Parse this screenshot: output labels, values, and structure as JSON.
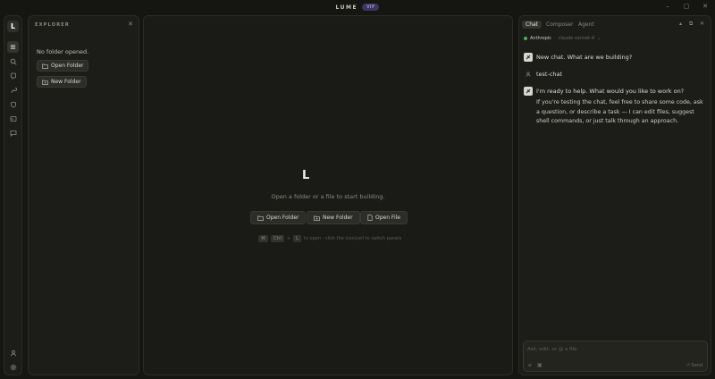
{
  "window": {
    "title": "LUME",
    "badge": "VIP"
  },
  "explorer": {
    "header": "EXPLORER",
    "empty_note": "No folder opened.",
    "open_folder_label": "Open Folder",
    "new_folder_label": "New Folder"
  },
  "editor": {
    "logo": "L",
    "hint": "Open a folder or a file to start building.",
    "open_folder_label": "Open Folder",
    "new_folder_label": "New Folder",
    "open_file_label": "Open File",
    "shortcut": {
      "keys": [
        "⌘",
        "Ctrl",
        "L"
      ],
      "text": "to open · click the icon/cell to switch panels"
    }
  },
  "chat": {
    "tabs": [
      "Chat",
      "Composer",
      "Agent"
    ],
    "active_tab": "Chat",
    "provider": "Anthropic",
    "model": "claude-sonnet-4",
    "messages": [
      {
        "role": "assistant",
        "text": "New chat. What are we building?"
      },
      {
        "role": "user",
        "text": "test-chat"
      },
      {
        "role": "assistant",
        "text": "I'm ready to help. What would you like to work on?",
        "detail": "If you're testing the chat, feel free to share some code, ask a question, or describe a task — I can edit files, suggest shell commands, or just talk through an approach."
      }
    ],
    "input_placeholder": "Ask, edit, or @ a file",
    "send_label": "⏎ Send"
  },
  "colors": {
    "accent": "#3a3660",
    "status_ok": "#4caf50",
    "background": "#151512"
  }
}
